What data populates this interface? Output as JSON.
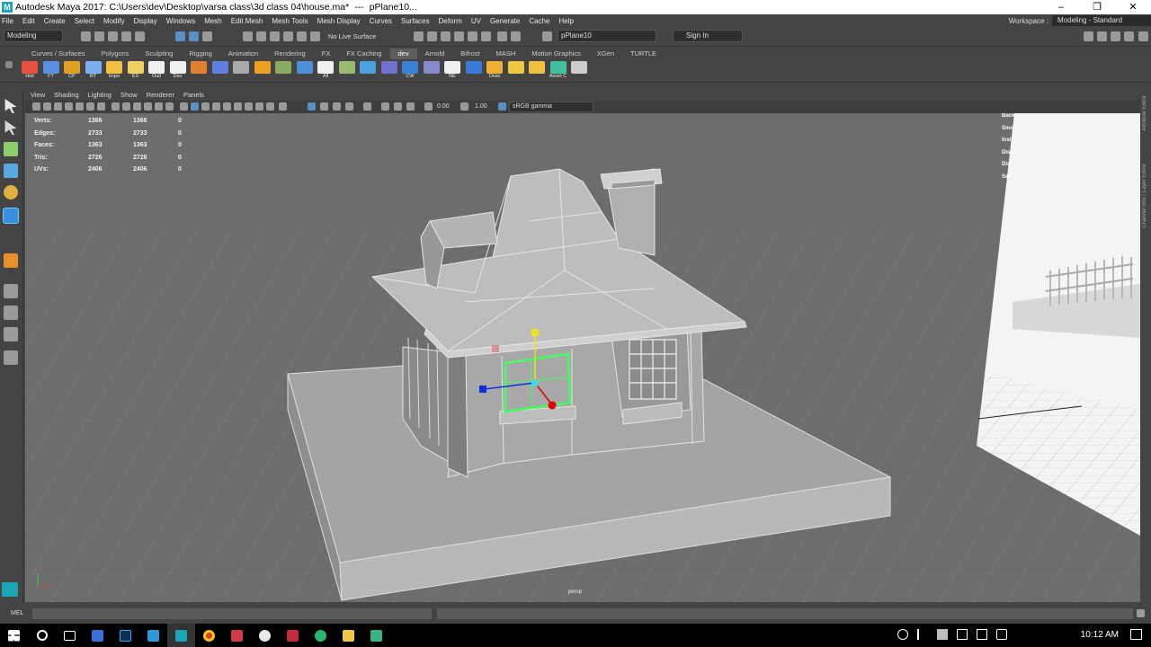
{
  "window": {
    "title": "Autodesk Maya 2017: C:\\Users\\dev\\Desktop\\varsa class\\3d class 04\\house.ma*",
    "separator": "---",
    "object": "pPlane10..."
  },
  "menubar": {
    "items": [
      "File",
      "Edit",
      "Create",
      "Select",
      "Modify",
      "Display",
      "Windows",
      "Mesh",
      "Edit Mesh",
      "Mesh Tools",
      "Mesh Display",
      "Curves",
      "Surfaces",
      "Deform",
      "UV",
      "Generate",
      "Cache",
      "Help"
    ],
    "workspace_label": "Workspace :",
    "workspace_value": "Modeling - Standard"
  },
  "statusline": {
    "mode": "Modeling",
    "live_surface": "No Live Surface",
    "object_field": "pPlane10",
    "sign_in": "Sign In"
  },
  "shelf": {
    "tabs": [
      "Curves / Surfaces",
      "Polygons",
      "Sculpting",
      "Rigging",
      "Animation",
      "Rendering",
      "FX",
      "FX Caching",
      "dev",
      "Arnold",
      "Bifrost",
      "MASH",
      "Motion Graphics",
      "XGen",
      "TURTLE"
    ],
    "active_tab": "dev",
    "buttons": [
      "Hist",
      "FT",
      "CP",
      "RT",
      "Impo",
      "ES",
      "Outl",
      "Dso",
      "",
      "",
      "",
      "",
      "",
      "",
      "All",
      "",
      "",
      "",
      "CW",
      "",
      "NE",
      "",
      "Osso",
      "",
      "",
      "Asset C",
      ""
    ]
  },
  "panel": {
    "menus": [
      "View",
      "Shading",
      "Lighting",
      "Show",
      "Renderer",
      "Panels"
    ],
    "exposure": "0.00",
    "gamma": "1.00",
    "color_space": "sRGB gamma"
  },
  "hud": {
    "rows": [
      {
        "label": "Verts:",
        "a": "1366",
        "b": "1366",
        "c": "0"
      },
      {
        "label": "Edges:",
        "a": "2733",
        "b": "2733",
        "c": "0"
      },
      {
        "label": "Faces:",
        "a": "1363",
        "b": "1363",
        "c": "0"
      },
      {
        "label": "Tris:",
        "a": "2726",
        "b": "2726",
        "c": "0"
      },
      {
        "label": "UVs:",
        "a": "2406",
        "b": "2406",
        "c": "0"
      }
    ],
    "camera": "persp"
  },
  "side_tabs": [
    "Attribute Editor",
    "Channel Box / Layer Editor"
  ],
  "channel_partial": [
    "Back",
    "Smo",
    "Inst",
    "Disp",
    "Dis",
    "Sel"
  ],
  "command_line": {
    "label": "MEL"
  },
  "taskbar": {
    "time": "10:12 AM"
  },
  "colors": {
    "maya_teal": "#1aa5b7",
    "viewport_bg": "#6d6d6d",
    "selection_green": "#40ff60",
    "manip_x": "#e00000",
    "manip_y": "#f0e020",
    "manip_z": "#1030e0"
  }
}
